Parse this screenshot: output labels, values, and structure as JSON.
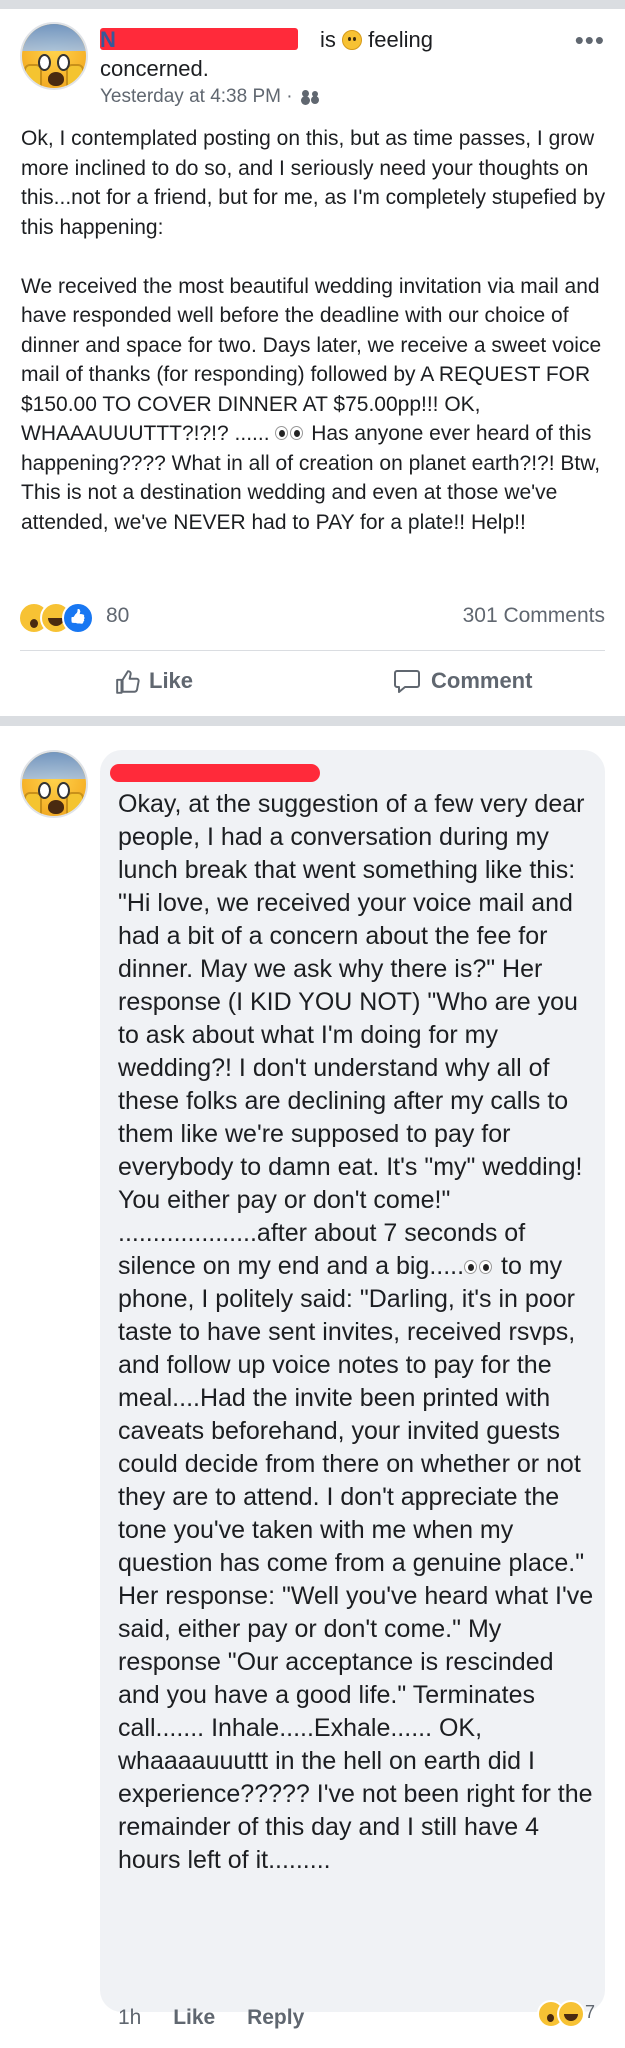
{
  "post": {
    "author_redacted": "N",
    "is_text": "is",
    "feeling_text": "feeling",
    "feeling_line2": "concerned.",
    "timestamp": "Yesterday at 4:38 PM ·",
    "paragraph1": "Ok, I contemplated posting on this, but as time passes, I grow more inclined to do so, and I seriously need your thoughts on this...not for a friend, but for me, as I'm completely stupefied by this happening:",
    "paragraph2a": "We received the most beautiful wedding invitation via mail and have responded well before the deadline with our choice of dinner and space for two. Days later, we receive a sweet voice mail of thanks (for responding) followed by A REQUEST FOR $150.00 TO COVER DINNER AT $75.00pp!!! OK, WHAAAUUUTTT?!?!? ......",
    "paragraph2b": " Has anyone ever heard of this happening???? What in all of creation on planet earth?!?! Btw, This is not a destination wedding and even at those we've attended, we've NEVER had to PAY for a plate!! Help!!",
    "reaction_count": "80",
    "comments_count": "301 Comments",
    "like_label": "Like",
    "comment_label": "Comment"
  },
  "comment": {
    "text_a": "Okay, at the suggestion of a few very dear people, I had a conversation during my lunch break that went something like this: \"Hi love, we received your voice mail and had a bit of a concern about the fee for dinner. May we ask why there is?\" Her response (I KID YOU NOT) \"Who are you to ask about what I'm doing for my wedding?! I don't understand why all of these folks are declining after my calls to them like we're supposed to pay for everybody to damn eat. It's \"my\" wedding! You either pay or don't come!\" ....................after about 7 seconds of silence on my end and a big.....",
    "text_b": " to my phone, I politely said: \"Darling, it's in poor taste to have sent invites, received rsvps, and follow up voice notes to pay for the meal....Had the invite been printed with caveats beforehand, your invited guests could decide from there on whether or not they are to attend. I don't appreciate the tone you've taken with me when my question has come from a genuine place.\"  Her response: \"Well you've heard what I've said, either pay or don't come.\" My response \"Our acceptance is rescinded and you have a good life.\" Terminates call....... Inhale.....Exhale...... OK, whaaaauuuttt in the hell on earth did I experience?????  I've not been right for the remainder of this day and I still have 4 hours left of it.........",
    "time": "1h",
    "like_label": "Like",
    "reply_label": "Reply",
    "reaction_count": "7"
  }
}
